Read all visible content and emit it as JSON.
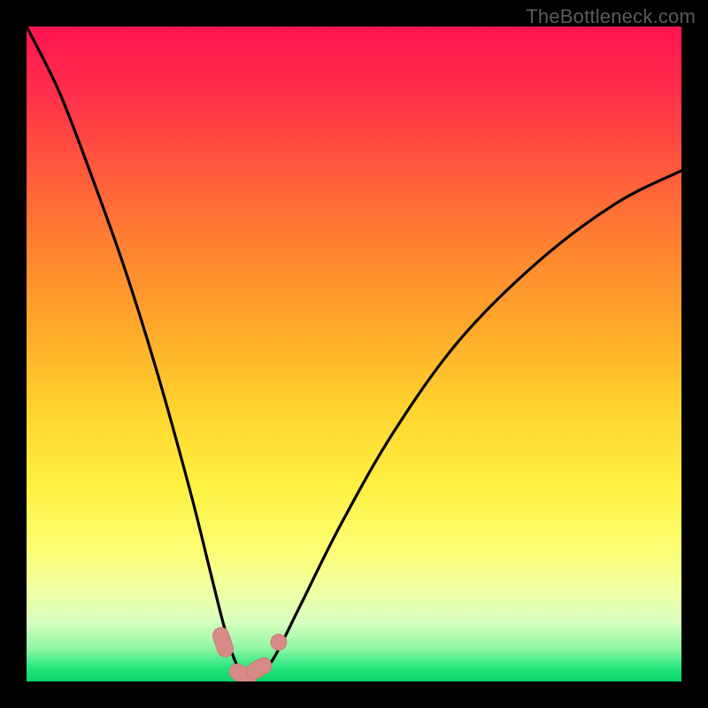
{
  "watermark": "TheBottleneck.com",
  "colors": {
    "frame": "#000000",
    "curve": "#000000",
    "marker_fill": "#d88b86",
    "marker_stroke": "#cf7a73"
  },
  "chart_data": {
    "type": "line",
    "title": "",
    "xlabel": "",
    "ylabel": "",
    "xlim": [
      0,
      100
    ],
    "ylim": [
      0,
      100
    ],
    "grid": false,
    "legend": false,
    "series": [
      {
        "name": "bottleneck-curve",
        "x": [
          0,
          5,
          10,
          15,
          20,
          25,
          28,
          30,
          31.5,
          33,
          34.5,
          36,
          38,
          42,
          48,
          56,
          66,
          78,
          90,
          100
        ],
        "y": [
          100,
          90,
          77,
          63,
          47,
          29,
          17,
          9,
          4,
          1,
          0.5,
          1.5,
          4,
          12,
          24,
          38,
          52,
          64,
          73,
          78
        ]
      }
    ],
    "annotations": [
      {
        "kind": "marker",
        "shape": "rounded-segment",
        "approx_x": 30.0,
        "approx_y": 6
      },
      {
        "kind": "marker",
        "shape": "rounded-segment",
        "approx_x": 33.0,
        "approx_y": 1
      },
      {
        "kind": "marker",
        "shape": "rounded-segment",
        "approx_x": 35.5,
        "approx_y": 2
      },
      {
        "kind": "marker",
        "shape": "rounded-dot",
        "approx_x": 38.5,
        "approx_y": 6
      }
    ]
  }
}
